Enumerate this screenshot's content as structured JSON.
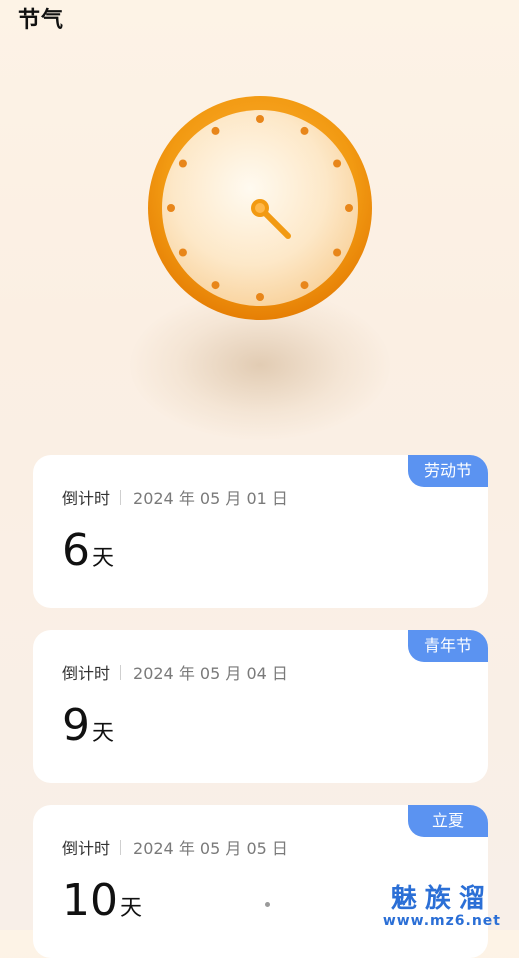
{
  "header": {
    "title": "节气"
  },
  "colors": {
    "accent_blue": "#5b93f1",
    "clock_orange": "#f0920d",
    "background": "#fbefe3"
  },
  "clock": {
    "icon": "clock-icon",
    "time_shown": "4:00"
  },
  "cards": [
    {
      "tag": "劳动节",
      "label": "倒计时",
      "date": "2024 年 05 月 01 日",
      "days": "6",
      "unit": "天"
    },
    {
      "tag": "青年节",
      "label": "倒计时",
      "date": "2024 年 05 月 04 日",
      "days": "9",
      "unit": "天"
    },
    {
      "tag": "立夏",
      "label": "倒计时",
      "date": "2024 年 05 月 05 日",
      "days": "10",
      "unit": "天"
    }
  ],
  "watermark": {
    "main": "魅族溜",
    "sub": "www.mz6.net"
  }
}
